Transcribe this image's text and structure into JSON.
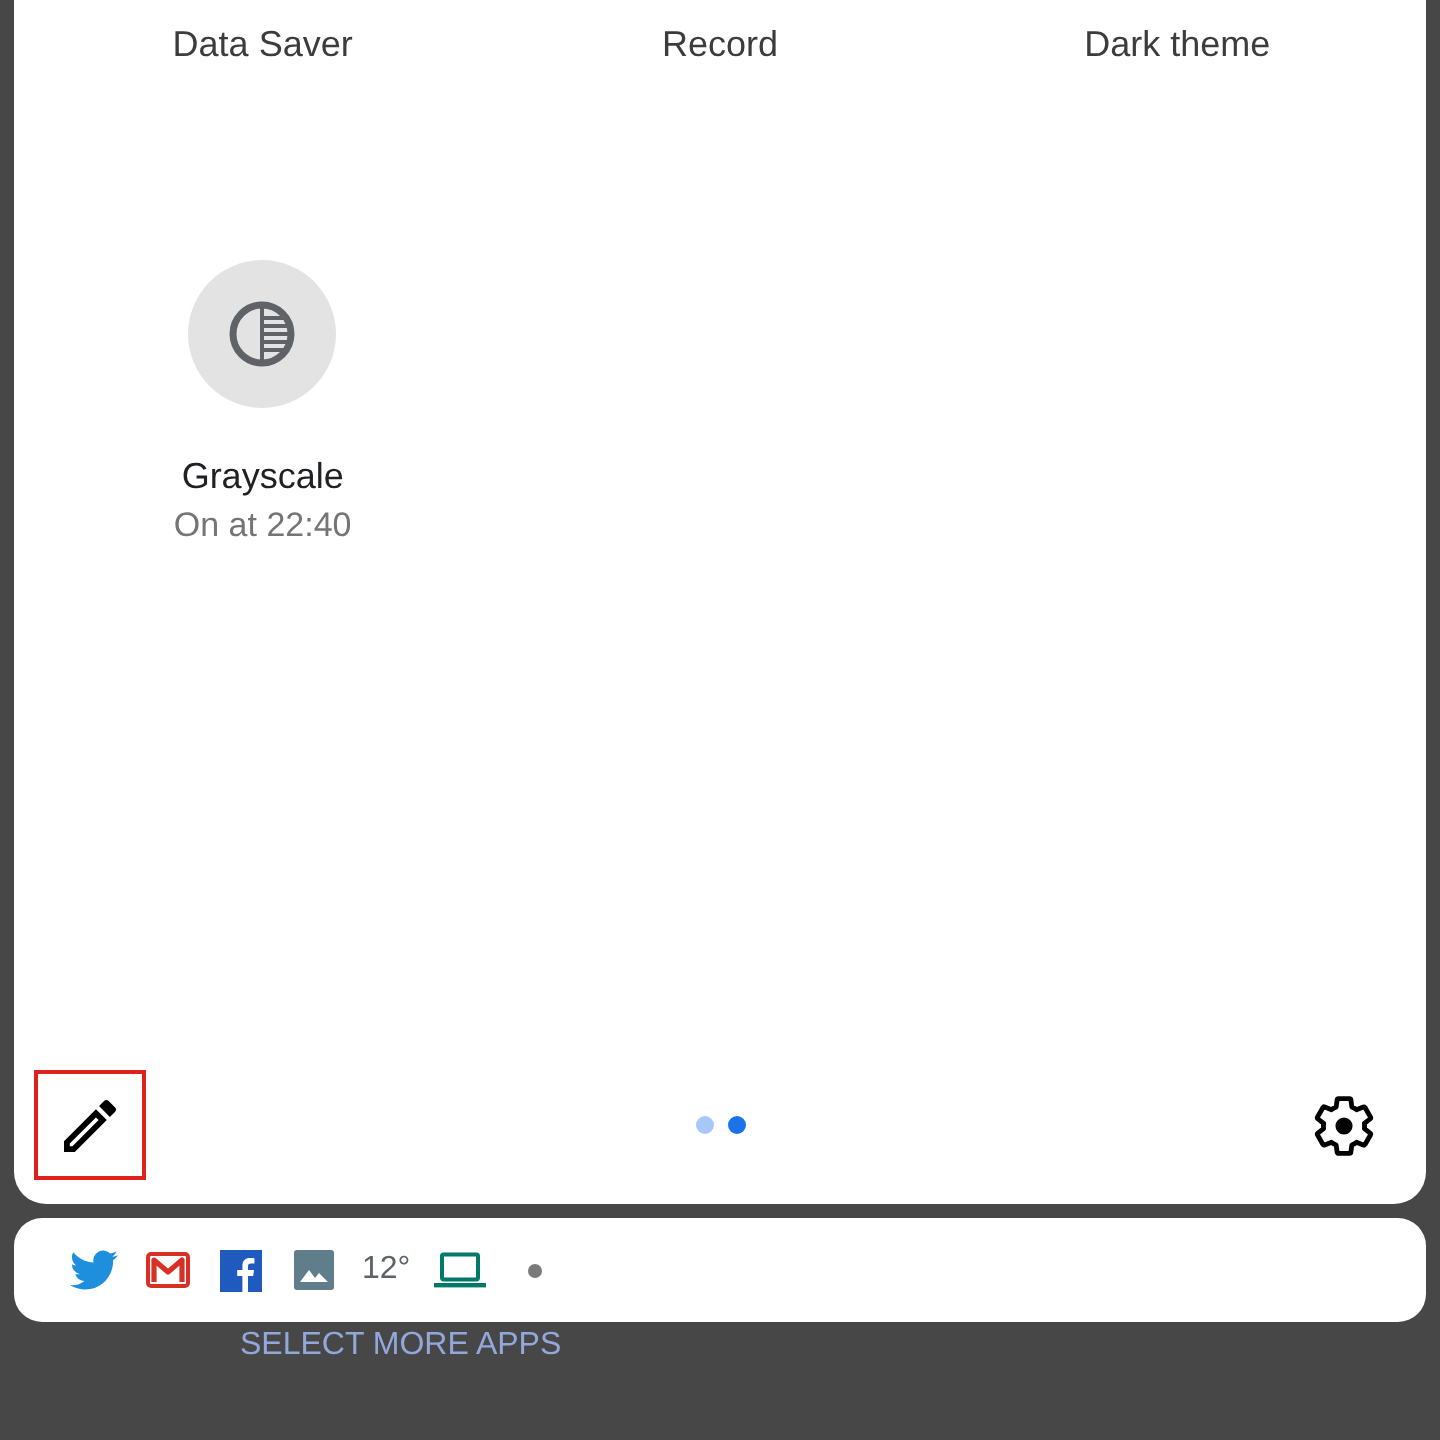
{
  "quick_settings": {
    "tiles_top_row": [
      {
        "label": "Data Saver"
      },
      {
        "label": "Record"
      },
      {
        "label": "Dark theme"
      }
    ],
    "tiles": [
      {
        "label": "Grayscale",
        "status": "On at 22:40",
        "active": false
      }
    ],
    "edit_button": {
      "highlighted": true
    },
    "page_indicator": [
      {
        "selected": false
      },
      {
        "selected": true
      }
    ]
  },
  "notification_bar": {
    "temperature": "12°"
  },
  "select_more_apps": "SELECT MORE APPS"
}
